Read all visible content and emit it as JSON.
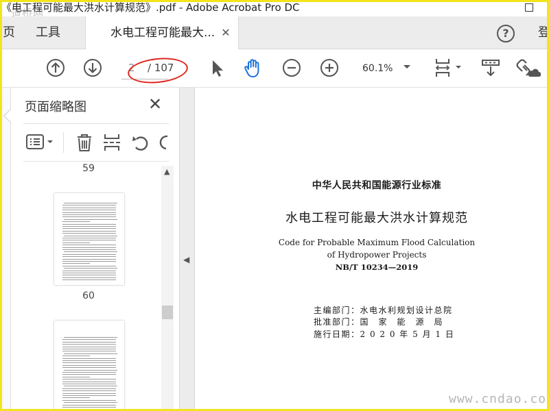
{
  "window": {
    "title": "《电工程可能最大洪水计算规范》.pdf - Adobe Acrobat Pro DC",
    "watermark_logo": "道桥网"
  },
  "tabs": {
    "home_cut": "页",
    "tools": "工具",
    "document": "水电工程可能最大...",
    "login_cut": "登"
  },
  "toolbar": {
    "current_page": "2",
    "total_pages": "/ 107",
    "zoom": "60.1%"
  },
  "thumbnail_panel": {
    "title": "页面缩略图",
    "pages": [
      "59",
      "60"
    ]
  },
  "document": {
    "standard_category": "中华人民共和国能源行业标准",
    "title_cn": "水电工程可能最大洪水计算规范",
    "title_en_line1": "Code for Probable Maximum Flood Calculation",
    "title_en_line2": "of Hydropower Projects",
    "code": "NB/T 10234—2019",
    "compiled_by": "主编部门：水电水利规划设计总院",
    "approved_by": "批准部门：国　家　能　源　局",
    "effective_date": "施行日期：2 0 2 0 年 5 月 1 日"
  },
  "watermark_text": "www.cndao.com",
  "colors": {
    "frame": "#f2e51a",
    "annotation": "#e0251c",
    "hand_tool": "#1a73d9"
  }
}
